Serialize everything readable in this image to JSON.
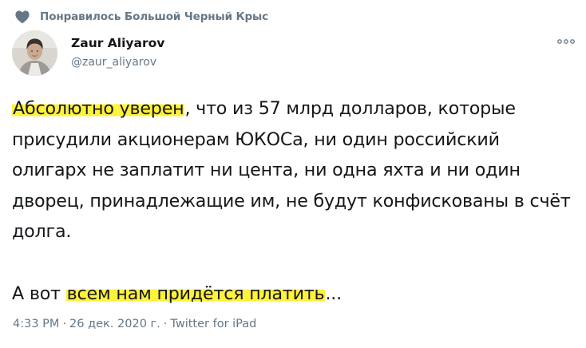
{
  "social_context": {
    "icon": "heart-icon",
    "text": "Понравилось Большой Черный Крыс"
  },
  "author": {
    "avatar": "avatar-photo",
    "name": "Zaur Aliyarov",
    "handle": "@zaur_aliyarov"
  },
  "more_icon": "more-options-icon",
  "tweet": {
    "p1_hl": "Абсолютно уверен",
    "p1_rest": ", что из 57 млрд долларов, которые присудили акционерам ЮКОСа, ни один российский олигарх не заплатит ни цента, ни одна яхта и ни один дворец, принадлежащие им, не будут конфискованы в счёт долга.",
    "p2_pre": "А вот ",
    "p2_hl": "всем нам придётся платить",
    "p2_post": "..."
  },
  "meta": {
    "time": "4:33 PM",
    "sep1": "·",
    "date": "26 дек. 2020 г.",
    "sep2": "·",
    "source": "Twitter for iPad"
  },
  "colors": {
    "text": "#14171a",
    "secondary": "#657786",
    "highlight": "#fff23a",
    "heart": "#657786"
  }
}
